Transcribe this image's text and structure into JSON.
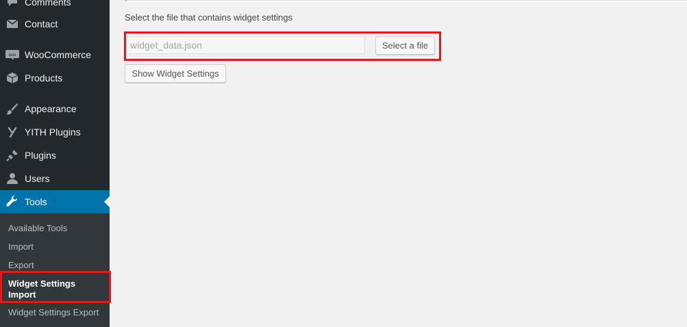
{
  "sidebar": {
    "items": [
      {
        "label": "Comments",
        "icon": "comments-icon"
      },
      {
        "label": "Contact",
        "icon": "envelope-icon"
      },
      {
        "label": "WooCommerce",
        "icon": "woocommerce-icon"
      },
      {
        "label": "Products",
        "icon": "box-icon"
      },
      {
        "label": "Appearance",
        "icon": "paintbrush-icon"
      },
      {
        "label": "YITH Plugins",
        "icon": "yith-icon"
      },
      {
        "label": "Plugins",
        "icon": "plug-icon"
      },
      {
        "label": "Users",
        "icon": "user-icon"
      },
      {
        "label": "Tools",
        "icon": "wrench-icon",
        "current": true
      }
    ],
    "submenu": [
      {
        "label": "Available Tools"
      },
      {
        "label": "Import"
      },
      {
        "label": "Export"
      },
      {
        "label": "Widget Settings Import",
        "line1": "Widget Settings",
        "line2": "Import",
        "active": true
      },
      {
        "label": "Widget Settings Export"
      }
    ],
    "woo_badge": "woo"
  },
  "main": {
    "description": "Select the file that contains widget settings",
    "file_input_value": "widget_data.json",
    "select_file_button": "Select a file",
    "show_settings_button": "Show Widget Settings"
  },
  "colors": {
    "sidebar_bg": "#23282d",
    "submenu_bg": "#32373c",
    "current_bg": "#0073aa",
    "highlight": "#e41a1a",
    "page_bg": "#f1f1f1"
  }
}
